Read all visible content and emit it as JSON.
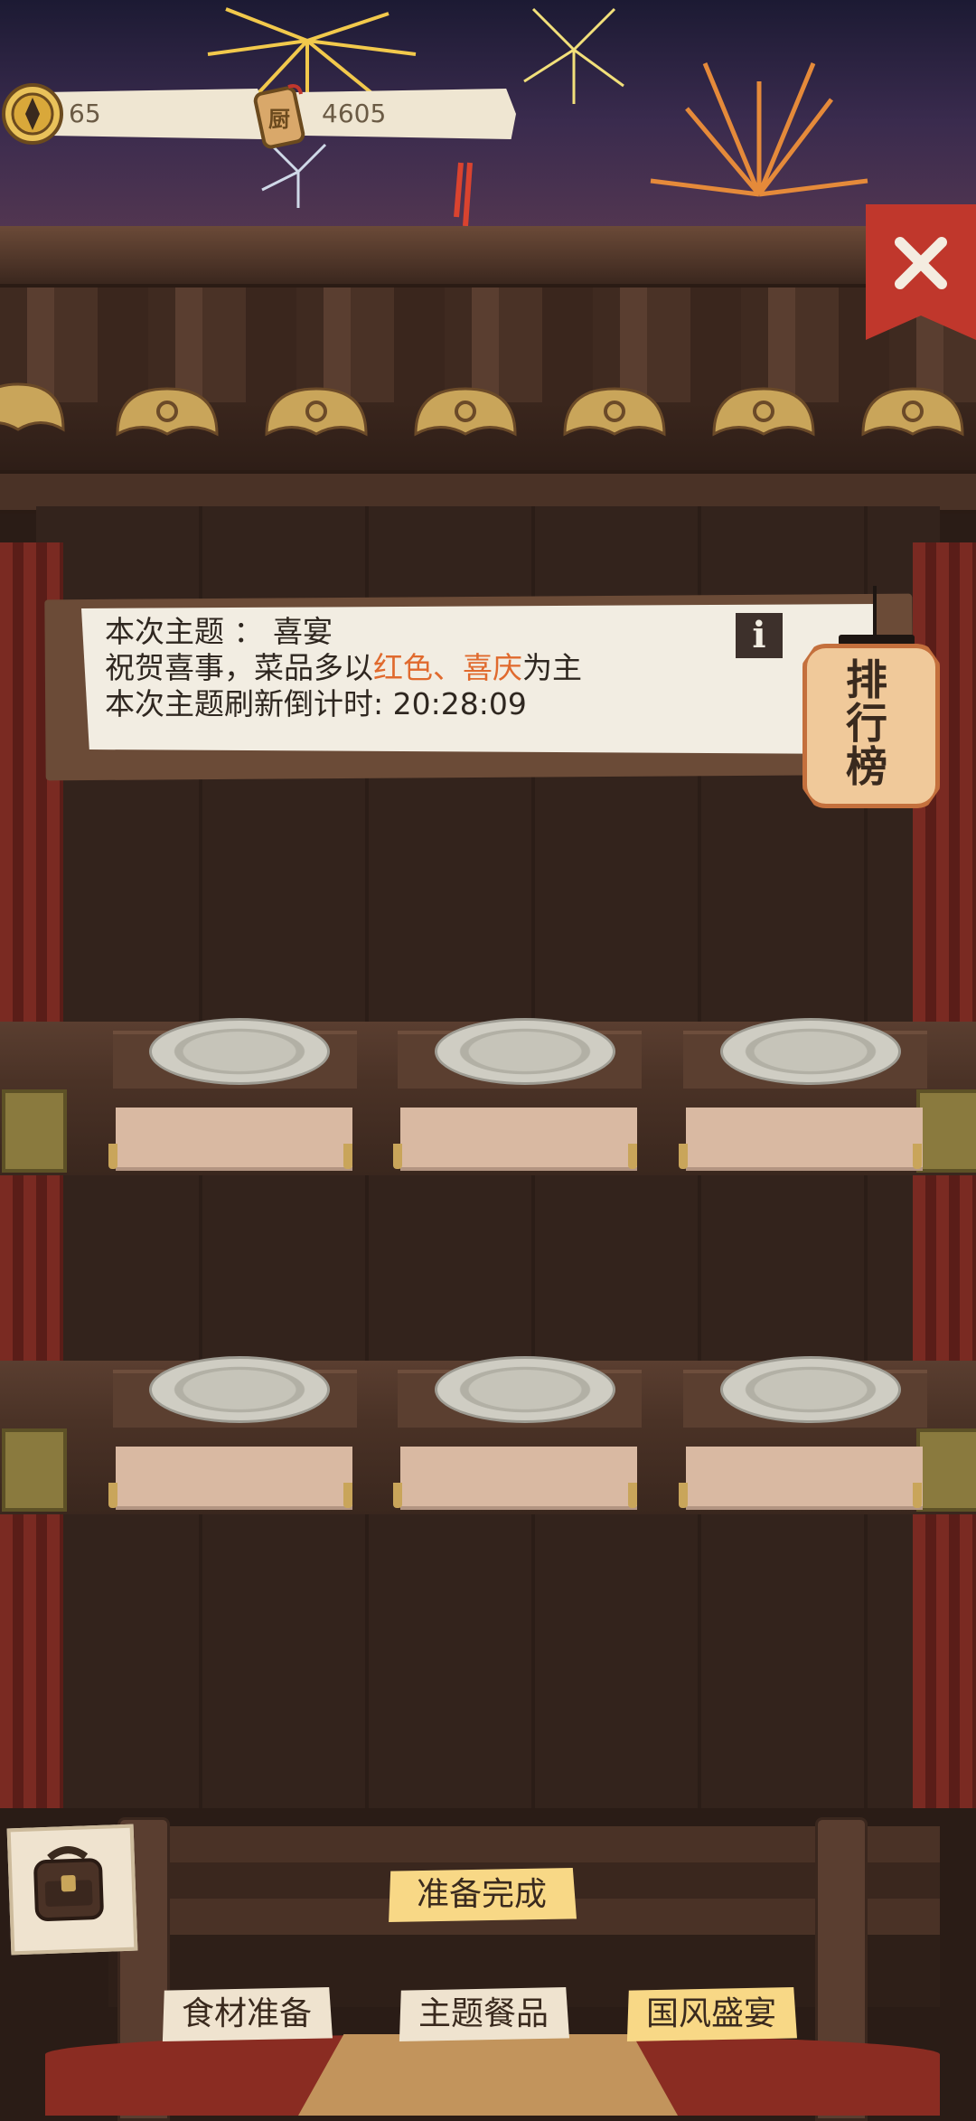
{
  "currency": {
    "coins": "65",
    "tokens": "4605"
  },
  "theme": {
    "line1": "本次主题 ： 喜宴",
    "line2_pre": "祝贺喜事，菜品多以",
    "line2_hl": "红色、喜庆",
    "line2_post": "为主",
    "line3": "本次主题刷新倒计时: 20:28:09",
    "info_label": "i"
  },
  "leaderboard": {
    "label": "排行榜"
  },
  "buttons": {
    "ready": "准备完成",
    "ingredients": "食材准备",
    "theme_dishes": "主题餐品",
    "feast": "国风盛宴"
  },
  "colors": {
    "highlight": "#e06a2e",
    "close": "#c0372c",
    "ready_button": "#f8d886"
  },
  "icons": [
    "coin-icon",
    "token-icon",
    "close-icon",
    "info-icon",
    "bag-icon"
  ]
}
